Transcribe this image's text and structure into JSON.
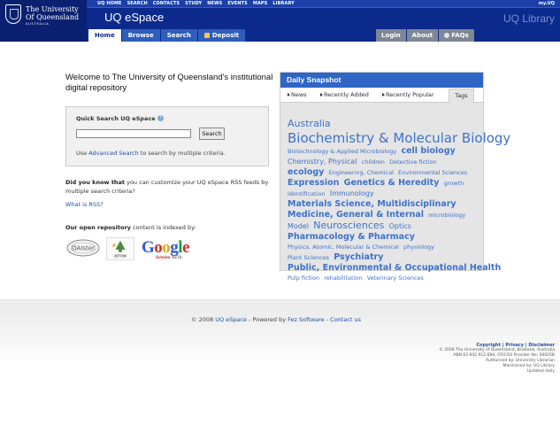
{
  "header": {
    "logo_line1": "The University",
    "logo_line2": "Of Queensland",
    "logo_line3": "AUSTRALIA",
    "site_title": "UQ eSpace",
    "site_right": "UQ Library",
    "top_links": [
      "UQ HOME",
      "SEARCH",
      "CONTACTS",
      "STUDY",
      "NEWS",
      "EVENTS",
      "MAPS",
      "LIBRARY"
    ],
    "my_uq": "my.UQ",
    "tabs": [
      "Home",
      "Browse",
      "Search",
      "Deposit"
    ],
    "right_tabs": [
      "Login",
      "About",
      "FAQs"
    ]
  },
  "intro": {
    "welcome": "Welcome to The University of Queensland's institutional digital repository"
  },
  "search": {
    "heading": "Quick Search UQ eSpace",
    "help": "?",
    "button": "Search",
    "adv_prefix": "Use ",
    "adv_link": "Advanced Search",
    "adv_suffix": " to search by multiple criteria."
  },
  "rss": {
    "did_bold": "Did you know that",
    "did_rest": " you can customize your UQ eSpace RSS feeds by multiple search criteria?",
    "what_link": "What is RSS?"
  },
  "indexed": {
    "bold": "Our open repository",
    "rest": " content is indexed by:"
  },
  "logos": {
    "oaister": "OAIster",
    "arrow": "arrow",
    "google": [
      "G",
      "o",
      "o",
      "g",
      "l",
      "e"
    ],
    "google_sub": "Scholar",
    "google_beta": "BETA"
  },
  "snapshot": {
    "title": "Daily Snapshot",
    "tabs": [
      "News",
      "Recently Added",
      "Recently Popular"
    ],
    "active_tab": "Tags",
    "tags": [
      {
        "label": "Australia",
        "size": 4
      },
      {
        "label": "Biochemistry & Molecular Biology",
        "size": 5
      },
      {
        "label": "Biotechnology & Applied Microbiology",
        "size": 1
      },
      {
        "label": "cell biology",
        "size": 3
      },
      {
        "label": "Chemistry, Physical",
        "size": 2
      },
      {
        "label": "children",
        "size": 1
      },
      {
        "label": "Detective fiction",
        "size": 1
      },
      {
        "label": "ecology",
        "size": 3
      },
      {
        "label": "Engineering, Chemical",
        "size": 1
      },
      {
        "label": "Environmental Sciences",
        "size": 1
      },
      {
        "label": "Expression",
        "size": 3
      },
      {
        "label": "Genetics & Heredity",
        "size": 3
      },
      {
        "label": "growth",
        "size": 1
      },
      {
        "label": "identification",
        "size": 1
      },
      {
        "label": "Immunology",
        "size": 2
      },
      {
        "label": "Materials Science, Multidisciplinary",
        "size": 3
      },
      {
        "label": "Medicine, General & Internal",
        "size": 3
      },
      {
        "label": "microbiology",
        "size": 1
      },
      {
        "label": "Model",
        "size": 2
      },
      {
        "label": "Neurosciences",
        "size": 4
      },
      {
        "label": "Optics",
        "size": 2
      },
      {
        "label": "Pharmacology & Pharmacy",
        "size": 3
      },
      {
        "label": "Physics, Atomic, Molecular & Chemical",
        "size": 1
      },
      {
        "label": "physiology",
        "size": 1
      },
      {
        "label": "Plant Sciences",
        "size": 1
      },
      {
        "label": "Psychiatry",
        "size": 3
      },
      {
        "label": "Public, Environmental & Occupational Health",
        "size": 3
      },
      {
        "label": "Pulp fiction",
        "size": 1
      },
      {
        "label": "rehabilitation",
        "size": 1
      },
      {
        "label": "Veterinary Sciences",
        "size": 1
      }
    ]
  },
  "footer": {
    "copy_prefix": "© 2008 ",
    "copy_link1": "UQ eSpace",
    "copy_mid": " - Powered by ",
    "copy_link2": "Fez Software",
    "copy_sep": " - ",
    "copy_link3": "Contact us",
    "right_links": "Copyright | Privacy | Disclaimer",
    "right_line1": "© 2008 The University of Queensland, Brisbane, Australia",
    "right_line2": "ABN 63 942 912 684, CRICOS Provider No: 00025B",
    "right_line3": "Authorised by: University Librarian",
    "right_line4": "Maintained by: UQ Library",
    "right_line5": "Updated daily"
  },
  "colors": {
    "header": "#0b2a8c",
    "accent": "#2f66c6",
    "link": "#1a4fa3"
  }
}
